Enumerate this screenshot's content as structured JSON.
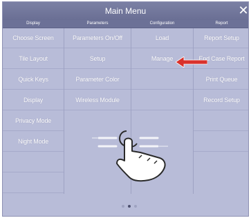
{
  "window": {
    "title": "Main Menu"
  },
  "columns": [
    {
      "header": "Display",
      "items": [
        "Choose Screen",
        "Tile Layout",
        "Quick Keys",
        "Display",
        "Privacy Mode",
        "Night Mode"
      ]
    },
    {
      "header": "Parameters",
      "items": [
        "Parameters On/Off",
        "Setup",
        "Parameter Color",
        "Wireless Module"
      ]
    },
    {
      "header": "Configuration",
      "items": [
        "Load",
        "Manage"
      ]
    },
    {
      "header": "Report",
      "items": [
        "Report Setup",
        "End Case Report",
        "Print Queue",
        "Record Setup"
      ]
    }
  ],
  "annotation": {
    "arrow_points_to": "Manage",
    "arrow_color": "#d9312b",
    "gesture": "swipe-horizontal-hand"
  },
  "pager": {
    "pages": 3,
    "current": 2
  },
  "colors": {
    "panel": "#b8bcd8",
    "title_bar": "#6a6f94",
    "header_bar": "#6c7197",
    "text": "#ffffff"
  }
}
